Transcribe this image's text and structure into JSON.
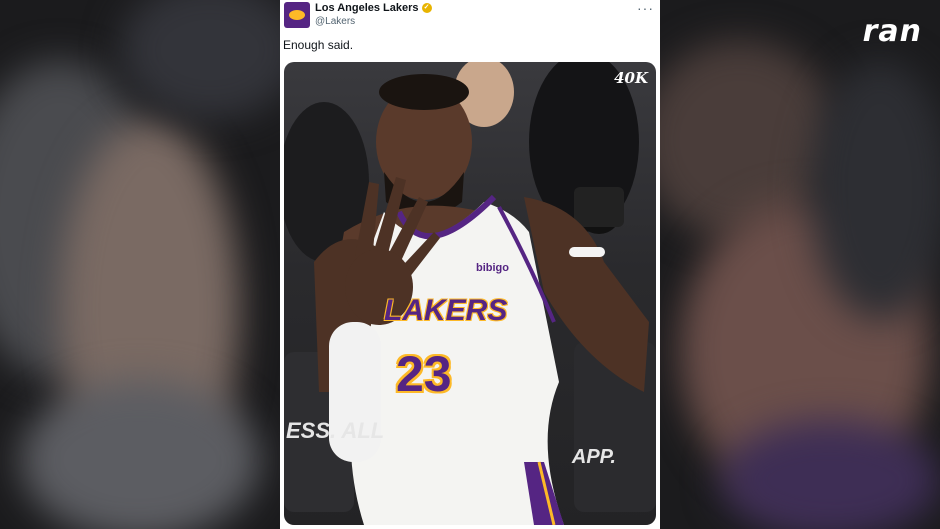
{
  "brand": {
    "logo_text": "ran"
  },
  "tweet": {
    "account_name": "Los Angeles Lakers",
    "handle": "@Lakers",
    "more_icon": "more-dots-icon",
    "verified_icon": "verified-badge-icon",
    "text": "Enough said."
  },
  "photo": {
    "watermark": "40K",
    "jersey_sponsor": "bibigo",
    "jersey_team": "LAKERS",
    "jersey_number": "23",
    "caption_left": "ESS. ALL",
    "caption_right": "APP.",
    "colors": {
      "purple": "#552583",
      "gold": "#fdb927"
    }
  }
}
